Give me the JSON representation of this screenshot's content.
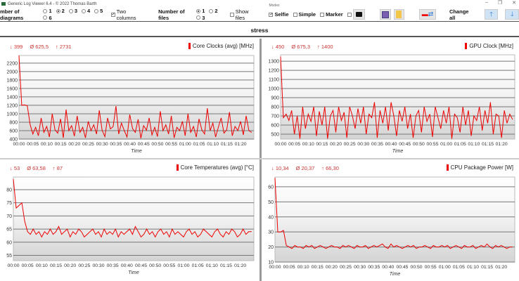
{
  "window": {
    "title": "Generic Log Viewer 6.4 - © 2022 Thomas Barth",
    "minimize": "–",
    "maximize": "❐",
    "close": "✕"
  },
  "toolbar": {
    "diagrams_label": "mber of diagrams",
    "diagram_options": [
      "1",
      "2",
      "3",
      "4",
      "5",
      "6"
    ],
    "diagrams_selected": "2",
    "two_columns": "Two columns",
    "two_columns_checked": true,
    "files_label": "Number of files",
    "file_options": [
      "1",
      "2",
      "3"
    ],
    "files_selected": "1",
    "show_files": "Show files",
    "modes_label": "Modes",
    "selfie": "Selfie",
    "simple": "Simple",
    "marker": "Marker",
    "change_all": "Change all"
  },
  "file_title": "stress",
  "chart_data": [
    {
      "type": "line",
      "title": "Core Clocks (avg) [MHz]",
      "stats": {
        "min": "↓ 399",
        "avg": "Ø 625,5",
        "max": "↑ 2731"
      },
      "xlabel": "Time",
      "ylim": [
        400,
        2380
      ],
      "yticks": [
        400,
        600,
        800,
        1000,
        1200,
        1400,
        1600,
        1800,
        2000,
        2200
      ],
      "color": "#ee0000",
      "x_minutes_step": 1,
      "values": [
        2380,
        1200,
        1210,
        1190,
        750,
        520,
        680,
        480,
        900,
        560,
        700,
        450,
        1000,
        620,
        540,
        880,
        430,
        1100,
        600,
        720,
        470,
        950,
        560,
        680,
        430,
        820,
        600,
        740,
        520,
        1080,
        610,
        460,
        900,
        640,
        700,
        1180,
        520,
        780,
        600,
        450,
        980,
        650,
        560,
        870,
        420,
        720,
        610,
        900,
        500,
        680,
        460,
        1060,
        600,
        740,
        520,
        950,
        430,
        680,
        600,
        820,
        480,
        1000,
        560,
        700,
        450,
        880,
        620,
        520,
        1130,
        600,
        780,
        450,
        690,
        900,
        540,
        620,
        1040,
        480,
        700,
        600,
        820,
        500,
        950,
        600,
        560
      ]
    },
    {
      "type": "line",
      "title": "GPU Clock [MHz]",
      "stats": {
        "min": "↓ 450",
        "avg": "Ø 675,3",
        "max": "↑ 1400"
      },
      "xlabel": "Time",
      "ylim": [
        446,
        1370
      ],
      "yticks": [
        500,
        600,
        700,
        800,
        900,
        1000,
        1100,
        1200,
        1300
      ],
      "color": "#ee0000",
      "x_minutes_step": 1,
      "values": [
        1350,
        680,
        720,
        650,
        760,
        500,
        700,
        450,
        800,
        560,
        720,
        640,
        800,
        480,
        750,
        600,
        800,
        450,
        700,
        760,
        520,
        800,
        650,
        740,
        460,
        800,
        700,
        560,
        780,
        620,
        800,
        500,
        720,
        680,
        850,
        460,
        760,
        620,
        800,
        540,
        850,
        700,
        480,
        760,
        640,
        800,
        560,
        720,
        460,
        700,
        760,
        520,
        800,
        640,
        720,
        470,
        800,
        680,
        560,
        760,
        620,
        800,
        450,
        720,
        680,
        520,
        800,
        600,
        760,
        480,
        700,
        650,
        800,
        540,
        760,
        620,
        850,
        500,
        720,
        700,
        460,
        760,
        620,
        720,
        660
      ]
    },
    {
      "type": "line",
      "title": "Core Temperatures (avg) [°C]",
      "stats": {
        "min": "↓ 53",
        "avg": "Ø 63,58",
        "max": "↑ 87"
      },
      "xlabel": "Time",
      "ylim": [
        53,
        84.8
      ],
      "yticks": [
        55,
        60,
        65,
        70,
        75,
        80
      ],
      "color": "#ee0000",
      "x_minutes_step": 1,
      "values": [
        84,
        73,
        74,
        75,
        68,
        64,
        63,
        65,
        63,
        64,
        62,
        64,
        63,
        65,
        63,
        64,
        66,
        63,
        64,
        65,
        62,
        64,
        63,
        65,
        64,
        62,
        63,
        64,
        65,
        63,
        64,
        62,
        65,
        63,
        64,
        63,
        65,
        62,
        64,
        63,
        64,
        65,
        63,
        66,
        64,
        62,
        63,
        65,
        63,
        64,
        62,
        64,
        65,
        63,
        64,
        62,
        65,
        63,
        64,
        63,
        62,
        64,
        65,
        63,
        64,
        62,
        63,
        65,
        64,
        63,
        62,
        64,
        65,
        63,
        62,
        64,
        63,
        65,
        64,
        62,
        63,
        65,
        63,
        64,
        64
      ]
    },
    {
      "type": "line",
      "title": "CPU Package Power [W]",
      "stats": {
        "min": "↓ 10,34",
        "avg": "Ø 20,37",
        "max": "↑ 66,30"
      },
      "xlabel": "Time",
      "ylim": [
        10,
        66.5
      ],
      "yticks": [
        10,
        20,
        30,
        40,
        50,
        60
      ],
      "color": "#ee0000",
      "x_minutes_step": 1,
      "values": [
        66,
        30,
        30,
        31,
        21,
        20,
        19,
        21,
        20,
        20,
        19,
        21,
        20,
        21,
        19,
        20,
        21,
        20,
        19,
        20,
        21,
        20,
        20,
        19,
        21,
        20,
        21,
        20,
        19,
        21,
        20,
        20,
        21,
        19,
        20,
        21,
        20,
        21,
        22,
        20,
        19,
        22,
        20,
        21,
        20,
        19,
        20,
        21,
        20,
        21,
        19,
        20,
        20,
        21,
        20,
        19,
        21,
        20,
        20,
        21,
        20,
        21,
        19,
        20,
        21,
        20,
        19,
        21,
        20,
        20,
        21,
        19,
        20,
        21,
        20,
        22,
        20,
        19,
        21,
        20,
        21,
        20,
        19,
        20,
        20
      ]
    }
  ]
}
